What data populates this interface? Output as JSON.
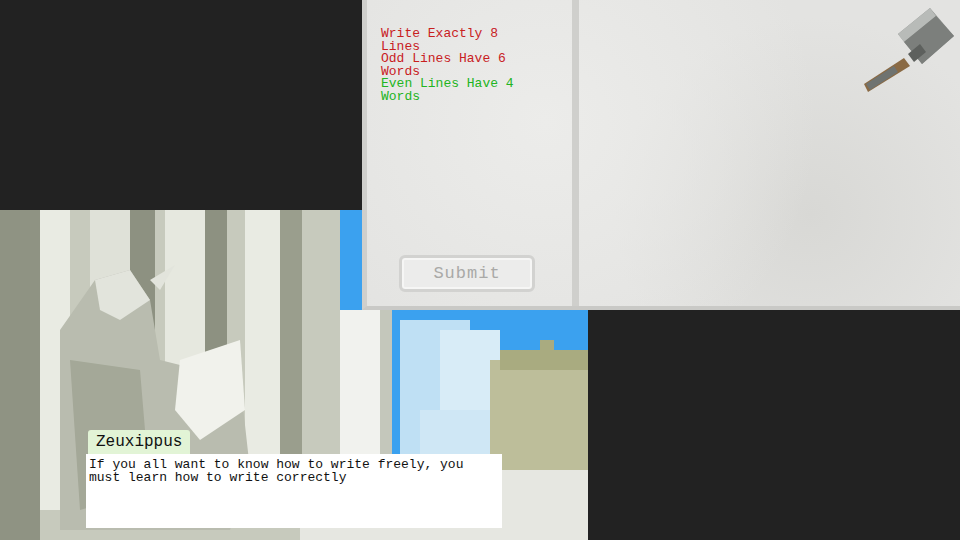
{
  "rules": [
    {
      "text": "Write Exactly 8 Lines",
      "color": "#c8201e"
    },
    {
      "text": "Odd Lines Have 6 Words",
      "color": "#c8201e"
    },
    {
      "text": "Even Lines Have 4 Words",
      "color": "#22b422"
    }
  ],
  "submit_button": {
    "label": "Submit",
    "disabled": true
  },
  "dialogue": {
    "speaker": "Zeuxippus",
    "text": "If you all want to know how to write freely, you must learn how to write correctly"
  }
}
